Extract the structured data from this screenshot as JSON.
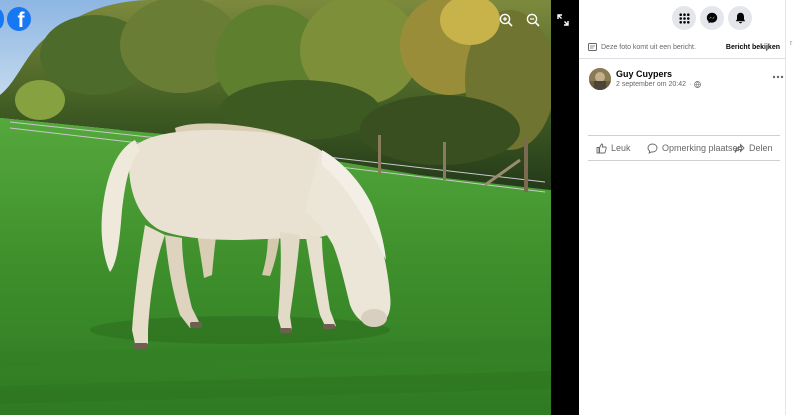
{
  "viewer": {
    "logo_letter": "f",
    "brand_color": "#1877f2",
    "icons": [
      "facebook-logo-icon",
      "zoom-in-icon",
      "zoom-out-icon",
      "fullscreen-icon"
    ]
  },
  "topbar": {
    "icons": [
      "menu-grid-icon",
      "messenger-icon",
      "notifications-bell-icon"
    ]
  },
  "notice": {
    "text": "Deze foto komt uit een bericht.",
    "link_label": "Bericht bekijken"
  },
  "post": {
    "author": "Guy Cuypers",
    "date": "2 september om 20:42",
    "separator": "·",
    "audience_icon": "globe-icon",
    "more_icon": "more-options-icon"
  },
  "actions": {
    "like_label": "Leuk",
    "comment_label": "Opmerking plaatsen",
    "share_label": "Delen"
  },
  "edge": {
    "label": "r"
  },
  "colors": {
    "text_primary": "#050505",
    "text_secondary": "#65676b",
    "icon_button_bg": "#e4e6eb",
    "viewer_bg": "#000000"
  }
}
